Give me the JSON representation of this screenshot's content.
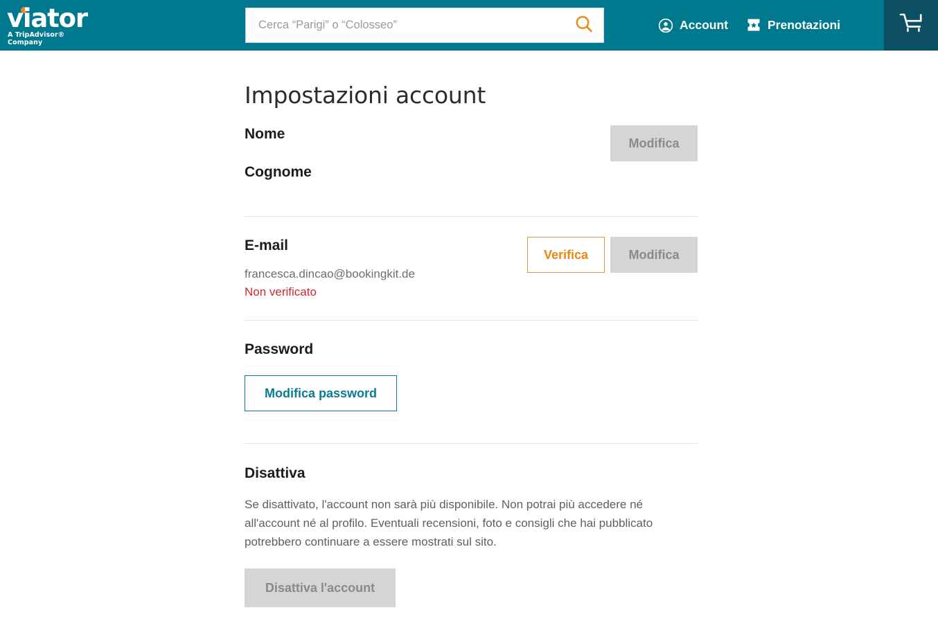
{
  "header": {
    "logo": {
      "wordmark": "viator",
      "tagline": "A TripAdvisor® Company",
      "dot_color": "#f5821f",
      "icon": "viator-logo"
    },
    "search": {
      "placeholder": "Cerca “Parigi” o “Colosseo”",
      "value": "",
      "icon": "search-icon",
      "icon_color": "#e8880f"
    },
    "nav": [
      {
        "label": "Account",
        "icon": "account-circle-icon"
      },
      {
        "label": "Prenotazioni",
        "icon": "ticket-icon"
      }
    ],
    "cart": {
      "icon": "shopping-cart-icon",
      "background": "#0c4f63"
    },
    "background": "#00798f"
  },
  "main": {
    "title": "Impostazioni account",
    "sections": [
      {
        "id": "name",
        "labels": [
          "Nome",
          "Cognome"
        ],
        "buttons": [
          {
            "label": "Modifica",
            "style": "disabled",
            "name": "edit-name-button"
          }
        ]
      },
      {
        "id": "email",
        "label": "E-mail",
        "value": "francesca.dincao@bookingkit.de",
        "status": "Non verificato",
        "status_color": "#cc2936",
        "buttons": [
          {
            "label": "Verifica",
            "style": "outline-orange",
            "name": "verify-email-button"
          },
          {
            "label": "Modifica",
            "style": "disabled",
            "name": "edit-email-button"
          }
        ]
      },
      {
        "id": "password",
        "label": "Password",
        "buttons": [
          {
            "label": "Modifica password",
            "style": "outline-teal",
            "name": "change-password-button"
          }
        ]
      },
      {
        "id": "deactivate",
        "label": "Disattiva",
        "description": "Se disattivato, l'account non sarà più disponibile. Non potrai più accedere né all'account né al profilo. Eventuali recensioni, foto e consigli che hai pubblicato potrebbero continuare a essere mostrati sul sito.",
        "buttons": [
          {
            "label": "Disattiva l'account",
            "style": "disabled",
            "name": "deactivate-account-button"
          }
        ]
      }
    ]
  }
}
